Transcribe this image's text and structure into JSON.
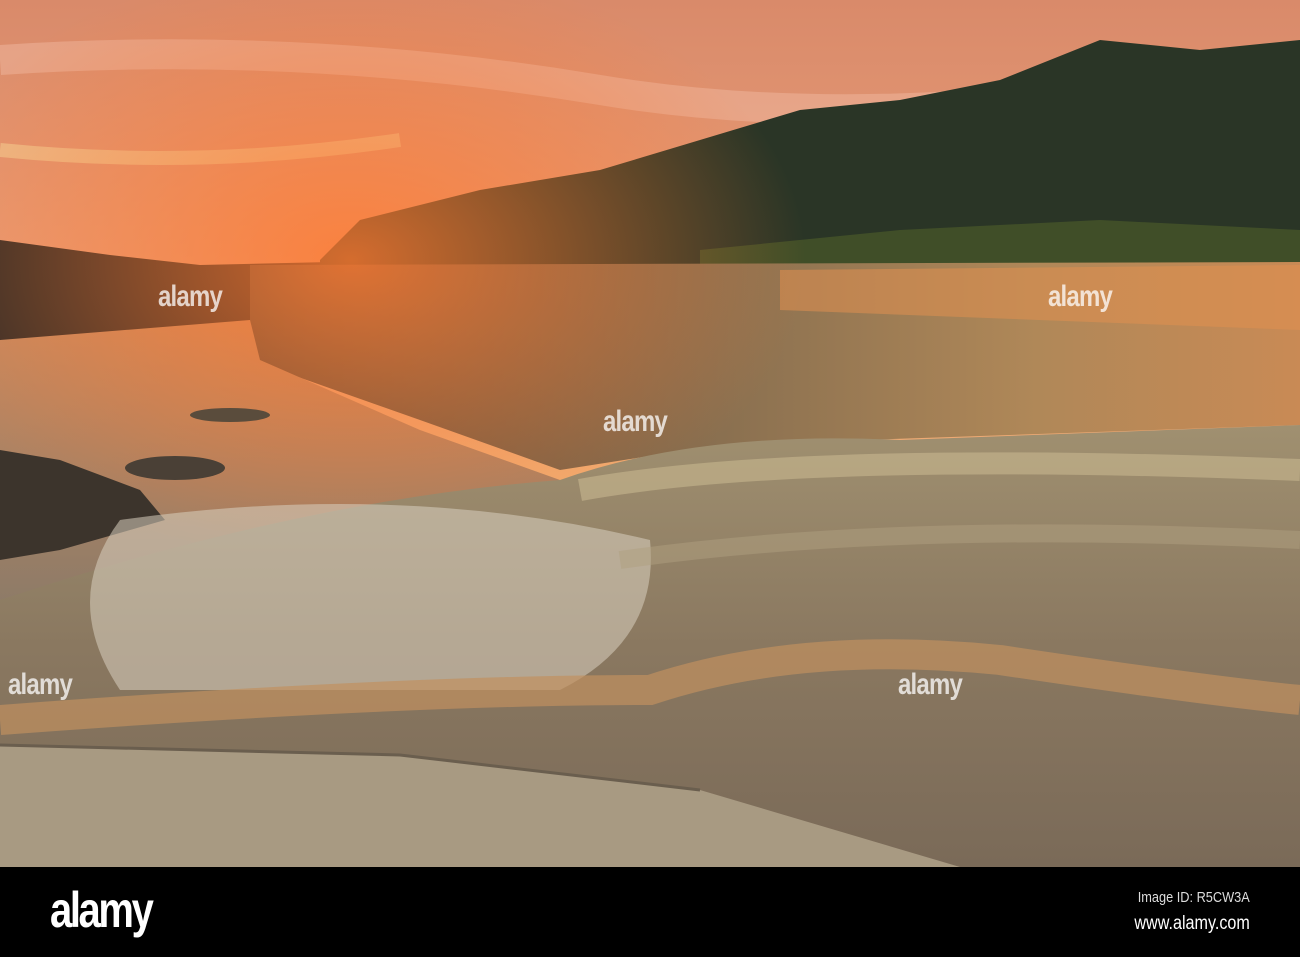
{
  "photo": {
    "subject": "waterfall-canyon-sunrise"
  },
  "watermark": {
    "text": "alamy"
  },
  "footer": {
    "logo": "alamy",
    "image_id": "Image ID: R5CW3A",
    "website": "www.alamy.com"
  }
}
